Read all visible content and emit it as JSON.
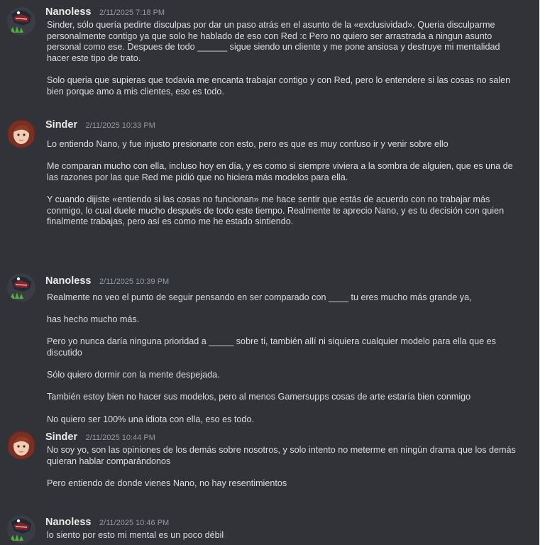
{
  "messages": [
    {
      "author": "Nanoless",
      "timestamp": "2/11/2025 7:18 PM",
      "avatar": "nanoless-avatar-icon",
      "paragraphs": [
        "Sinder, sólo quería pedirte disculpas por dar un paso atrás en el asunto de la «exclusividad». Queria disculparme personalmente contigo ya que solo he hablado de eso con Red :c Pero no quiero ser arrastrada a ningun asunto personal como ese. Despues de todo ______ sigue siendo un cliente y me pone ansiosa y destruye mi mentalidad hacer este tipo de trato.",
        "Solo queria que supieras que todavia me encanta trabajar contigo y con Red, pero lo entendere si las cosas no salen bien porque amo a mis clientes, eso es todo."
      ]
    },
    {
      "author": "Sinder",
      "timestamp": "2/11/2025 10:33 PM",
      "avatar": "sinder-avatar-icon",
      "paragraphs": [
        "Lo entiendo Nano, y fue injusto presionarte con esto, pero es que es muy confuso ir y venir sobre ello",
        "Me comparan mucho con ella, incluso hoy en día, y es como si siempre viviera a la sombra de alguien, que es una de las razones por las que Red me pidió que no hiciera más modelos para ella.",
        "Y cuando dijiste «entiendo si las cosas no funcionan» me hace sentir que estás de acuerdo con no trabajar más conmigo, lo cual duele mucho después de todo este tiempo. Realmente te aprecio Nano, y es tu decisión con quien finalmente trabajas, pero así es como me he estado sintiendo."
      ]
    },
    {
      "author": "Nanoless",
      "timestamp": "2/11/2025 10:39 PM",
      "avatar": "nanoless-avatar-icon",
      "paragraphs": [
        "Realmente no veo el punto de seguir pensando en ser comparado con ____ tu eres mucho más grande ya,",
        "has hecho mucho más.",
        "Pero yo nunca daría ninguna prioridad a _____ sobre ti, también allí ni siquiera cualquier modelo para ella que es discutido",
        "Sólo quiero dormir con la mente despejada.",
        "También estoy bien no hacer sus modelos, pero al menos Gamersupps cosas de arte estaría bien conmigo",
        "No quiero ser 100% una idiota con ella, eso es todo."
      ]
    },
    {
      "author": "Sinder",
      "timestamp": "2/11/2025 10:44 PM",
      "avatar": "sinder-avatar-icon",
      "paragraphs": [
        "No soy yo, son las opiniones de los demás sobre nosotros, y solo intento no meterme en ningún drama que los demás quieran hablar comparándonos",
        "Pero entiendo de donde vienes Nano, no hay resentimientos"
      ]
    },
    {
      "author": "Nanoless",
      "timestamp": "2/11/2025 10:46 PM",
      "avatar": "nanoless-avatar-icon",
      "paragraphs": [
        "lo siento por esto mi mental es un poco débil"
      ]
    }
  ]
}
